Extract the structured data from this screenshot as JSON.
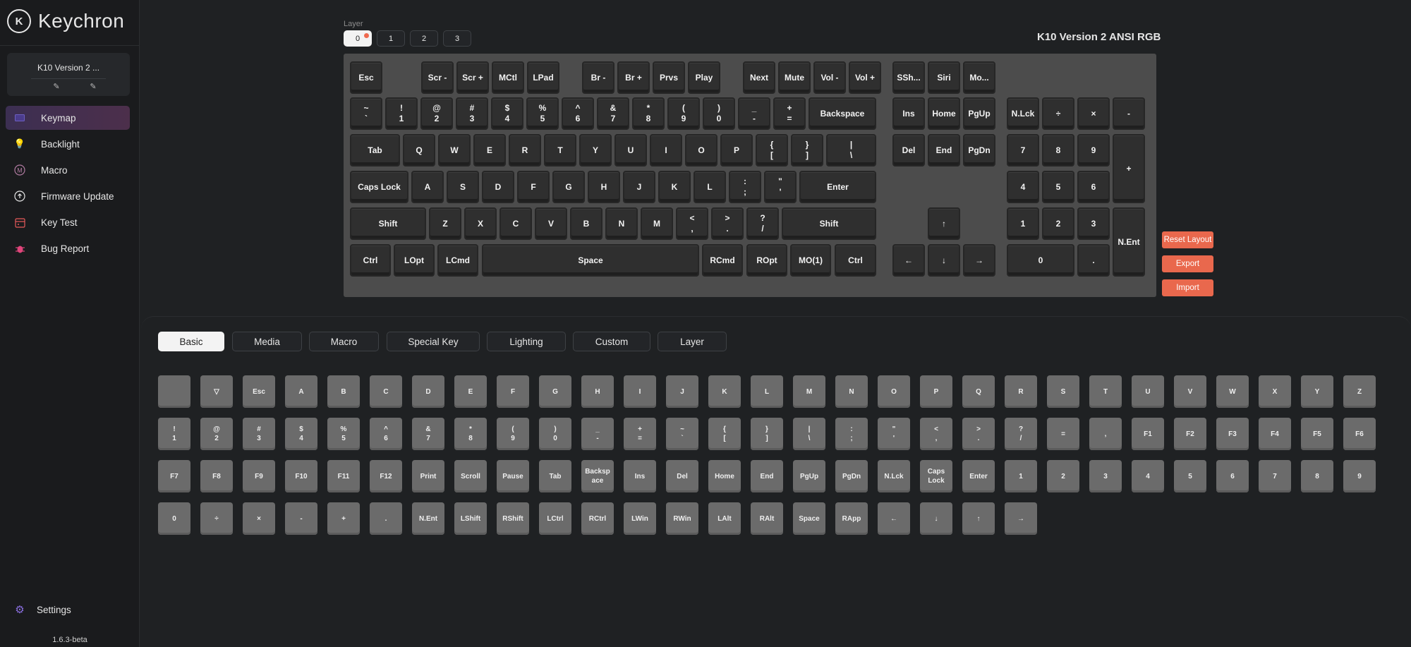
{
  "brand": {
    "name": "Keychron",
    "logo_text": "K"
  },
  "device": {
    "name": "K10 Version 2 ...",
    "edit_icon": "pencil-icon",
    "disconnect_icon": "pencil-icon"
  },
  "nav": [
    {
      "id": "keymap",
      "label": "Keymap",
      "icon": "keyboard-icon",
      "active": true
    },
    {
      "id": "backlight",
      "label": "Backlight",
      "icon": "bulb-icon",
      "active": false
    },
    {
      "id": "macro",
      "label": "Macro",
      "icon": "macro-icon",
      "active": false
    },
    {
      "id": "firmware-update",
      "label": "Firmware Update",
      "icon": "upload-icon",
      "active": false
    },
    {
      "id": "key-test",
      "label": "Key Test",
      "icon": "calendar-icon",
      "active": false
    },
    {
      "id": "bug-report",
      "label": "Bug Report",
      "icon": "bug-icon",
      "active": false
    }
  ],
  "settings": {
    "label": "Settings",
    "icon": "gear-icon"
  },
  "version": "1.6.3-beta",
  "layers": {
    "label": "Layer",
    "tabs": [
      "0",
      "1",
      "2",
      "3"
    ],
    "active": "0"
  },
  "model_title": "K10 Version 2 ANSI RGB",
  "actions": {
    "reset": "Reset Layout",
    "export": "Export",
    "import": "Import"
  },
  "keyboard": {
    "row0": [
      {
        "k": "esc",
        "t": "Esc"
      },
      {
        "k": "f1",
        "t": "Scr -"
      },
      {
        "k": "f2",
        "t": "Scr +"
      },
      {
        "k": "f3",
        "t": "MCtl"
      },
      {
        "k": "f4",
        "t": "LPad"
      },
      {
        "k": "f5",
        "t": "Br -"
      },
      {
        "k": "f6",
        "t": "Br +"
      },
      {
        "k": "f7",
        "t": "Prvs"
      },
      {
        "k": "f8",
        "t": "Play"
      },
      {
        "k": "f9",
        "t": "Next"
      },
      {
        "k": "f10",
        "t": "Mute"
      },
      {
        "k": "f11",
        "t": "Vol -"
      },
      {
        "k": "f12",
        "t": "Vol +"
      },
      {
        "k": "screenshot",
        "t": "SSh..."
      },
      {
        "k": "siri",
        "t": "Siri"
      },
      {
        "k": "mode",
        "t": "Mo..."
      }
    ],
    "row1": [
      {
        "k": "grave",
        "t": "~",
        "b": "`"
      },
      {
        "k": "1",
        "t": "!",
        "b": "1"
      },
      {
        "k": "2",
        "t": "@",
        "b": "2"
      },
      {
        "k": "3",
        "t": "#",
        "b": "3"
      },
      {
        "k": "4",
        "t": "$",
        "b": "4"
      },
      {
        "k": "5",
        "t": "%",
        "b": "5"
      },
      {
        "k": "6",
        "t": "^",
        "b": "6"
      },
      {
        "k": "7",
        "t": "&",
        "b": "7"
      },
      {
        "k": "8",
        "t": "*",
        "b": "8"
      },
      {
        "k": "9",
        "t": "(",
        "b": "9"
      },
      {
        "k": "0",
        "t": ")",
        "b": "0"
      },
      {
        "k": "minus",
        "t": "_",
        "b": "-"
      },
      {
        "k": "equal",
        "t": "+",
        "b": "="
      },
      {
        "k": "backspace",
        "t": "Backspace"
      },
      {
        "k": "ins",
        "t": "Ins"
      },
      {
        "k": "home",
        "t": "Home"
      },
      {
        "k": "pgup",
        "t": "PgUp"
      },
      {
        "k": "nlck",
        "t": "N.Lck"
      },
      {
        "k": "kp-div",
        "t": "÷"
      },
      {
        "k": "kp-mul",
        "t": "×"
      },
      {
        "k": "kp-minus",
        "t": "-"
      }
    ],
    "row2": [
      {
        "k": "tab",
        "t": "Tab"
      },
      {
        "k": "q",
        "t": "Q"
      },
      {
        "k": "w",
        "t": "W"
      },
      {
        "k": "e",
        "t": "E"
      },
      {
        "k": "r",
        "t": "R"
      },
      {
        "k": "t",
        "t": "T"
      },
      {
        "k": "y",
        "t": "Y"
      },
      {
        "k": "u",
        "t": "U"
      },
      {
        "k": "i",
        "t": "I"
      },
      {
        "k": "o",
        "t": "O"
      },
      {
        "k": "p",
        "t": "P"
      },
      {
        "k": "lbracket",
        "t": "{",
        "b": "["
      },
      {
        "k": "rbracket",
        "t": "}",
        "b": "]"
      },
      {
        "k": "backslash",
        "t": "|",
        "b": "\\"
      },
      {
        "k": "del",
        "t": "Del"
      },
      {
        "k": "end",
        "t": "End"
      },
      {
        "k": "pgdn",
        "t": "PgDn"
      },
      {
        "k": "kp7",
        "t": "7"
      },
      {
        "k": "kp8",
        "t": "8"
      },
      {
        "k": "kp9",
        "t": "9"
      },
      {
        "k": "kp-plus",
        "t": "+"
      }
    ],
    "row3": [
      {
        "k": "caps",
        "t": "Caps Lock"
      },
      {
        "k": "a",
        "t": "A"
      },
      {
        "k": "s",
        "t": "S"
      },
      {
        "k": "d",
        "t": "D"
      },
      {
        "k": "f",
        "t": "F"
      },
      {
        "k": "g",
        "t": "G"
      },
      {
        "k": "h",
        "t": "H"
      },
      {
        "k": "j",
        "t": "J"
      },
      {
        "k": "k",
        "t": "K"
      },
      {
        "k": "l",
        "t": "L"
      },
      {
        "k": "semicolon",
        "t": ":",
        "b": ";"
      },
      {
        "k": "quote",
        "t": "\"",
        "b": "'"
      },
      {
        "k": "enter",
        "t": "Enter"
      },
      {
        "k": "kp4",
        "t": "4"
      },
      {
        "k": "kp5",
        "t": "5"
      },
      {
        "k": "kp6",
        "t": "6"
      }
    ],
    "row4": [
      {
        "k": "lshift",
        "t": "Shift"
      },
      {
        "k": "z",
        "t": "Z"
      },
      {
        "k": "x",
        "t": "X"
      },
      {
        "k": "c",
        "t": "C"
      },
      {
        "k": "v",
        "t": "V"
      },
      {
        "k": "b",
        "t": "B"
      },
      {
        "k": "n",
        "t": "N"
      },
      {
        "k": "m",
        "t": "M"
      },
      {
        "k": "comma",
        "t": "<",
        "b": ","
      },
      {
        "k": "period",
        "t": ">",
        "b": "."
      },
      {
        "k": "slash",
        "t": "?",
        "b": "/"
      },
      {
        "k": "rshift",
        "t": "Shift"
      },
      {
        "k": "up",
        "t": "↑"
      },
      {
        "k": "kp1",
        "t": "1"
      },
      {
        "k": "kp2",
        "t": "2"
      },
      {
        "k": "kp3",
        "t": "3"
      },
      {
        "k": "kp-enter",
        "t": "N.Ent"
      }
    ],
    "row5": [
      {
        "k": "lctrl",
        "t": "Ctrl"
      },
      {
        "k": "lopt",
        "t": "LOpt"
      },
      {
        "k": "lcmd",
        "t": "LCmd"
      },
      {
        "k": "space",
        "t": "Space"
      },
      {
        "k": "rcmd",
        "t": "RCmd"
      },
      {
        "k": "ropt",
        "t": "ROpt"
      },
      {
        "k": "mo1",
        "t": "MO(1)"
      },
      {
        "k": "rctrl",
        "t": "Ctrl"
      },
      {
        "k": "left",
        "t": "←"
      },
      {
        "k": "down",
        "t": "↓"
      },
      {
        "k": "right",
        "t": "→"
      },
      {
        "k": "kp0",
        "t": "0"
      },
      {
        "k": "kp-dot",
        "t": "."
      }
    ]
  },
  "categories": {
    "tabs": [
      "Basic",
      "Media",
      "Macro",
      "Special Key",
      "Lighting",
      "Custom",
      "Layer"
    ],
    "active": "Basic"
  },
  "palette": [
    [
      {
        "t": ""
      },
      {
        "t": "▽"
      },
      {
        "t": "Esc"
      },
      {
        "t": "A"
      },
      {
        "t": "B"
      },
      {
        "t": "C"
      },
      {
        "t": "D"
      },
      {
        "t": "E"
      },
      {
        "t": "F"
      },
      {
        "t": "G"
      },
      {
        "t": "H"
      },
      {
        "t": "I"
      },
      {
        "t": "J"
      },
      {
        "t": "K"
      },
      {
        "t": "L"
      },
      {
        "t": "M"
      },
      {
        "t": "N"
      },
      {
        "t": "O"
      },
      {
        "t": "P"
      },
      {
        "t": "Q"
      },
      {
        "t": "R"
      },
      {
        "t": "S"
      },
      {
        "t": "T"
      },
      {
        "t": "U"
      },
      {
        "t": "V"
      },
      {
        "t": "W"
      },
      {
        "t": "X"
      },
      {
        "t": "Y"
      },
      {
        "t": "Z"
      }
    ],
    [
      {
        "t": "!",
        "b": "1"
      },
      {
        "t": "@",
        "b": "2"
      },
      {
        "t": "#",
        "b": "3"
      },
      {
        "t": "$",
        "b": "4"
      },
      {
        "t": "%",
        "b": "5"
      },
      {
        "t": "^",
        "b": "6"
      },
      {
        "t": "&",
        "b": "7"
      },
      {
        "t": "*",
        "b": "8"
      },
      {
        "t": "(",
        "b": "9"
      },
      {
        "t": ")",
        "b": "0"
      },
      {
        "t": "_",
        "b": "-"
      },
      {
        "t": "+",
        "b": "="
      },
      {
        "t": "~",
        "b": "`"
      },
      {
        "t": "{",
        "b": "["
      },
      {
        "t": "}",
        "b": "]"
      },
      {
        "t": "|",
        "b": "\\"
      },
      {
        "t": ":",
        "b": ";"
      },
      {
        "t": "\"",
        "b": "'"
      },
      {
        "t": "<",
        "b": ","
      },
      {
        "t": ">",
        "b": "."
      },
      {
        "t": "?",
        "b": "/"
      },
      {
        "t": "="
      },
      {
        "t": ","
      },
      {
        "t": "F1"
      },
      {
        "t": "F2"
      },
      {
        "t": "F3"
      },
      {
        "t": "F4"
      },
      {
        "t": "F5"
      },
      {
        "t": "F6"
      }
    ],
    [
      {
        "t": "F7"
      },
      {
        "t": "F8"
      },
      {
        "t": "F9"
      },
      {
        "t": "F10"
      },
      {
        "t": "F11"
      },
      {
        "t": "F12"
      },
      {
        "t": "Print"
      },
      {
        "t": "Scroll"
      },
      {
        "t": "Pause"
      },
      {
        "t": "Tab"
      },
      {
        "t": "Backsp",
        "b": "ace"
      },
      {
        "t": "Ins"
      },
      {
        "t": "Del"
      },
      {
        "t": "Home"
      },
      {
        "t": "End"
      },
      {
        "t": "PgUp"
      },
      {
        "t": "PgDn"
      },
      {
        "t": "N.Lck"
      },
      {
        "t": "Caps",
        "b": "Lock"
      },
      {
        "t": "Enter"
      },
      {
        "t": "1"
      },
      {
        "t": "2"
      },
      {
        "t": "3"
      },
      {
        "t": "4"
      },
      {
        "t": "5"
      },
      {
        "t": "6"
      },
      {
        "t": "7"
      },
      {
        "t": "8"
      },
      {
        "t": "9"
      }
    ],
    [
      {
        "t": "0"
      },
      {
        "t": "÷"
      },
      {
        "t": "×"
      },
      {
        "t": "-"
      },
      {
        "t": "+"
      },
      {
        "t": "."
      },
      {
        "t": "N.Ent"
      },
      {
        "t": "LShift"
      },
      {
        "t": "RShift"
      },
      {
        "t": "LCtrl"
      },
      {
        "t": "RCtrl"
      },
      {
        "t": "LWin"
      },
      {
        "t": "RWin"
      },
      {
        "t": "LAlt"
      },
      {
        "t": "RAlt"
      },
      {
        "t": "Space"
      },
      {
        "t": "RApp"
      },
      {
        "t": "←"
      },
      {
        "t": "↓"
      },
      {
        "t": "↑"
      },
      {
        "t": "→"
      }
    ]
  ]
}
